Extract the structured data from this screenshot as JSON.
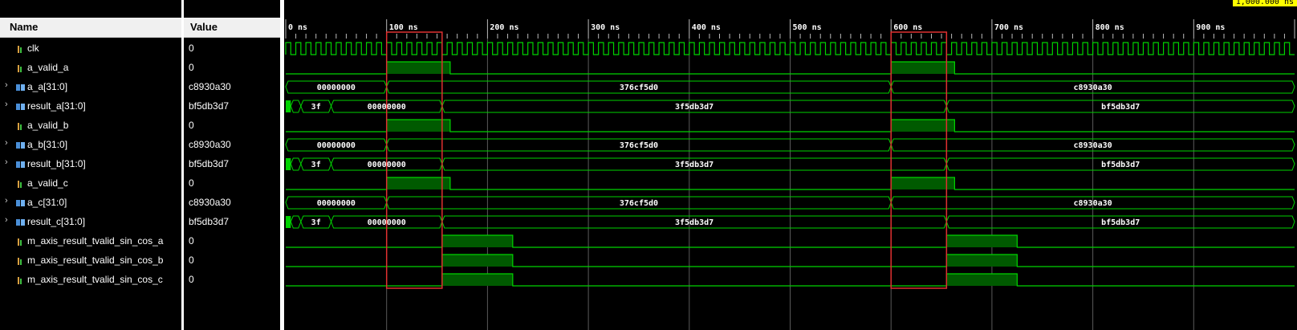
{
  "header": {
    "name_label": "Name",
    "value_label": "Value"
  },
  "cursor_label": "1,000.000 ns",
  "time_axis": {
    "unit": "ns",
    "start": 0,
    "end": 1000,
    "labels": [
      "0 ns",
      "100 ns",
      "200 ns",
      "300 ns",
      "400 ns",
      "500 ns",
      "600 ns",
      "700 ns",
      "800 ns",
      "900 ns"
    ]
  },
  "colors": {
    "wave": "#00d200",
    "wave_fill": "#005a00",
    "marker": "#e03030",
    "grid": "#5a5a5a",
    "cursor": "#ffff00"
  },
  "markers": [
    {
      "from_ns": 100,
      "to_ns": 155
    },
    {
      "from_ns": 600,
      "to_ns": 655
    }
  ],
  "signals": [
    {
      "name": "clk",
      "value": "0",
      "kind": "clock",
      "bus": false,
      "period_ns": 10
    },
    {
      "name": "a_valid_a",
      "value": "0",
      "kind": "bit",
      "bus": false,
      "high": [
        [
          100,
          163
        ],
        [
          600,
          663
        ]
      ]
    },
    {
      "name": "a_a[31:0]",
      "value": "c8930a30",
      "kind": "bus",
      "bus": true,
      "segments": [
        {
          "from": 0,
          "to": 100,
          "text": "00000000"
        },
        {
          "from": 100,
          "to": 600,
          "text": "376cf5d0"
        },
        {
          "from": 600,
          "to": 1000,
          "text": "c8930a30"
        }
      ]
    },
    {
      "name": "result_a[31:0]",
      "value": "bf5db3d7",
      "kind": "bus",
      "bus": true,
      "pulse": [
        0,
        5
      ],
      "segments": [
        {
          "from": 5,
          "to": 15,
          "text": ""
        },
        {
          "from": 15,
          "to": 45,
          "text": "3f"
        },
        {
          "from": 45,
          "to": 155,
          "text": "00000000"
        },
        {
          "from": 155,
          "to": 655,
          "text": "3f5db3d7"
        },
        {
          "from": 655,
          "to": 1000,
          "text": "bf5db3d7"
        }
      ]
    },
    {
      "name": "a_valid_b",
      "value": "0",
      "kind": "bit",
      "bus": false,
      "high": [
        [
          100,
          163
        ],
        [
          600,
          663
        ]
      ]
    },
    {
      "name": "a_b[31:0]",
      "value": "c8930a30",
      "kind": "bus",
      "bus": true,
      "segments": [
        {
          "from": 0,
          "to": 100,
          "text": "00000000"
        },
        {
          "from": 100,
          "to": 600,
          "text": "376cf5d0"
        },
        {
          "from": 600,
          "to": 1000,
          "text": "c8930a30"
        }
      ]
    },
    {
      "name": "result_b[31:0]",
      "value": "bf5db3d7",
      "kind": "bus",
      "bus": true,
      "pulse": [
        0,
        5
      ],
      "segments": [
        {
          "from": 5,
          "to": 15,
          "text": ""
        },
        {
          "from": 15,
          "to": 45,
          "text": "3f"
        },
        {
          "from": 45,
          "to": 155,
          "text": "00000000"
        },
        {
          "from": 155,
          "to": 655,
          "text": "3f5db3d7"
        },
        {
          "from": 655,
          "to": 1000,
          "text": "bf5db3d7"
        }
      ]
    },
    {
      "name": "a_valid_c",
      "value": "0",
      "kind": "bit",
      "bus": false,
      "high": [
        [
          100,
          163
        ],
        [
          600,
          663
        ]
      ]
    },
    {
      "name": "a_c[31:0]",
      "value": "c8930a30",
      "kind": "bus",
      "bus": true,
      "segments": [
        {
          "from": 0,
          "to": 100,
          "text": "00000000"
        },
        {
          "from": 100,
          "to": 600,
          "text": "376cf5d0"
        },
        {
          "from": 600,
          "to": 1000,
          "text": "c8930a30"
        }
      ]
    },
    {
      "name": "result_c[31:0]",
      "value": "bf5db3d7",
      "kind": "bus",
      "bus": true,
      "pulse": [
        0,
        5
      ],
      "segments": [
        {
          "from": 5,
          "to": 15,
          "text": ""
        },
        {
          "from": 15,
          "to": 45,
          "text": "3f"
        },
        {
          "from": 45,
          "to": 155,
          "text": "00000000"
        },
        {
          "from": 155,
          "to": 655,
          "text": "3f5db3d7"
        },
        {
          "from": 655,
          "to": 1000,
          "text": "bf5db3d7"
        }
      ]
    },
    {
      "name": "m_axis_result_tvalid_sin_cos_a",
      "value": "0",
      "kind": "bit",
      "bus": false,
      "high": [
        [
          155,
          225
        ],
        [
          655,
          725
        ]
      ]
    },
    {
      "name": "m_axis_result_tvalid_sin_cos_b",
      "value": "0",
      "kind": "bit",
      "bus": false,
      "high": [
        [
          155,
          225
        ],
        [
          655,
          725
        ]
      ]
    },
    {
      "name": "m_axis_result_tvalid_sin_cos_c",
      "value": "0",
      "kind": "bit",
      "bus": false,
      "high": [
        [
          155,
          225
        ],
        [
          655,
          725
        ]
      ]
    }
  ]
}
